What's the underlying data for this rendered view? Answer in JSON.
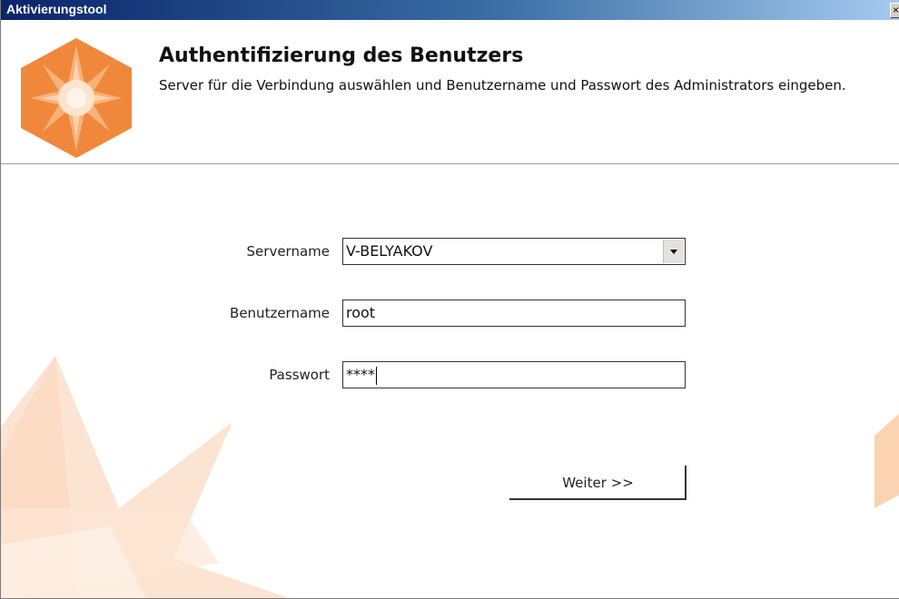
{
  "window": {
    "title": "Aktivierungstool",
    "close_glyph": "×"
  },
  "header": {
    "heading": "Authentifizierung des Benutzers",
    "subtitle": "Server für die Verbindung auswählen und Benutzername und Passwort des Administrators eingeben.",
    "logo_icon": "orange-star-hexagon-icon"
  },
  "form": {
    "server_label": "Servername",
    "server_value": "V-BELYAKOV",
    "username_label": "Benutzername",
    "username_value": "root",
    "password_label": "Passwort",
    "password_value": "****"
  },
  "buttons": {
    "next_label": "Weiter >>"
  },
  "colors": {
    "accent_orange": "#f0883c",
    "decor_peach": "#fbd3b2",
    "titlebar_dark": "#0a246a",
    "titlebar_light": "#a6caf0"
  }
}
